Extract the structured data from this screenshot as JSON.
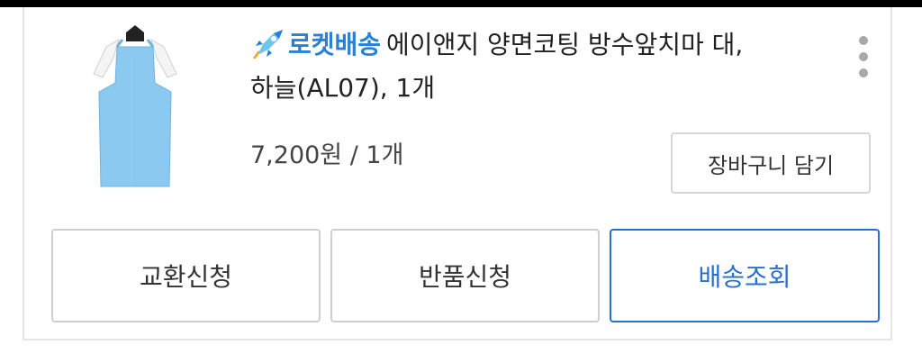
{
  "product": {
    "badge": "로켓배송",
    "name": "에이앤지 양면코팅 방수앞치마 대,",
    "name_line2": "하늘(AL07), 1개",
    "price": "7,200원 / 1개",
    "image": "light-blue-apron-icon"
  },
  "buttons": {
    "cart": "장바구니 담기",
    "exchange": "교환신청",
    "return": "반품신청",
    "track": "배송조회"
  },
  "icons": {
    "badge": "rocket-icon",
    "menu": "more-vertical-icon"
  },
  "colors": {
    "badge": "#2a7fd6",
    "track": "#2a6fd0",
    "apron": "#8cc9f0"
  }
}
